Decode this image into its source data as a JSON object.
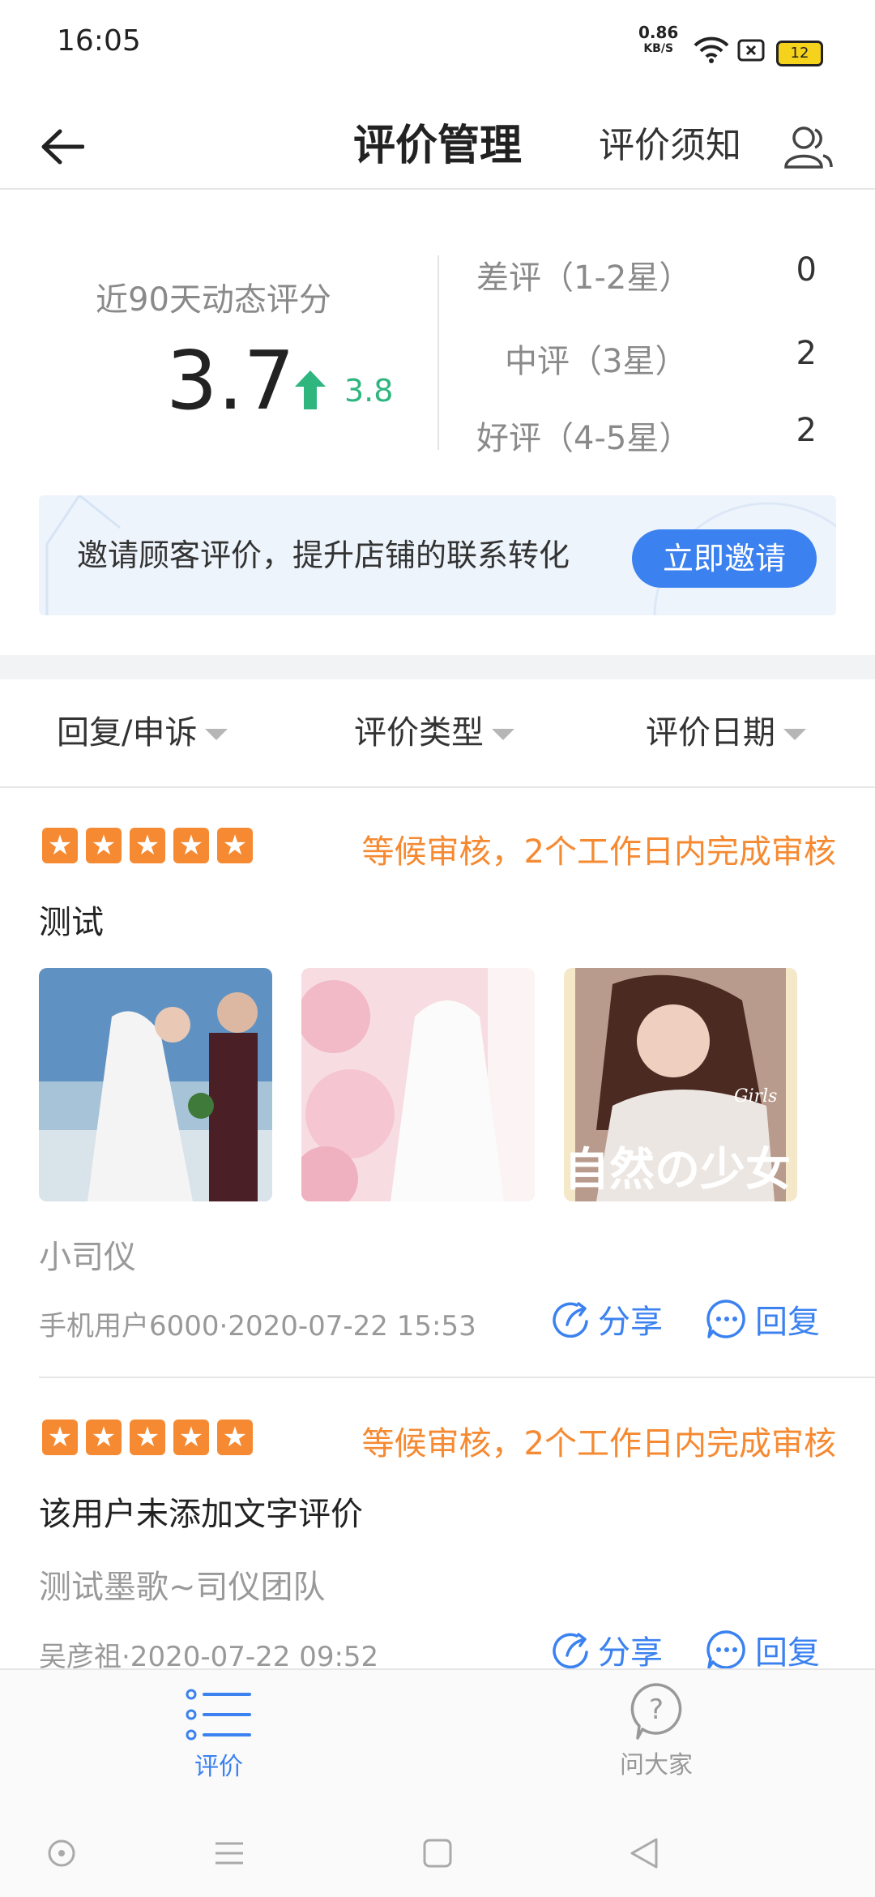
{
  "status_bar": {
    "time": "16:05",
    "net_speed": "0.86",
    "net_unit": "KB/S",
    "battery": "12"
  },
  "header": {
    "title": "评价管理",
    "notice_link": "评价须知"
  },
  "score": {
    "label": "近90天动态评分",
    "value": "3.7",
    "previous": "3.8",
    "colors": {
      "up": "#2fb67f"
    }
  },
  "ratings": [
    {
      "label": "差评（1-2星）",
      "count": "0"
    },
    {
      "label": "中评（3星）",
      "count": "2"
    },
    {
      "label": "好评（4-5星）",
      "count": "2"
    }
  ],
  "banner": {
    "text": "邀请顾客评价，提升店铺的联系转化",
    "button": "立即邀请"
  },
  "filters": [
    {
      "label": "回复/申诉"
    },
    {
      "label": "评价类型"
    },
    {
      "label": "评价日期"
    }
  ],
  "reviews": [
    {
      "stars": 5,
      "status": "等候审核，2个工作日内完成审核",
      "content": "测试",
      "photos": [
        {
          "desc": "wedding-beach-photo"
        },
        {
          "desc": "bride-flowers-photo"
        },
        {
          "desc": "girl-portrait-photo",
          "overlay": "自然の少女",
          "tag": "Girls"
        }
      ],
      "store": "小司仪",
      "meta": "手机用户6000·2020-07-22 15:53",
      "share": "分享",
      "reply": "回复"
    },
    {
      "stars": 5,
      "status": "等候审核，2个工作日内完成审核",
      "content": "该用户未添加文字评价",
      "store": "测试墨歌~司仪团队",
      "meta": "吴彦祖·2020-07-22 09:52",
      "share": "分享",
      "reply": "回复"
    }
  ],
  "bottom_nav": [
    {
      "label": "评价",
      "icon": "list-icon",
      "active": true
    },
    {
      "label": "问大家",
      "icon": "question-icon",
      "active": false
    }
  ],
  "colors": {
    "accent": "#3b82f0",
    "star": "#f58a32",
    "status": "#f58a32"
  }
}
